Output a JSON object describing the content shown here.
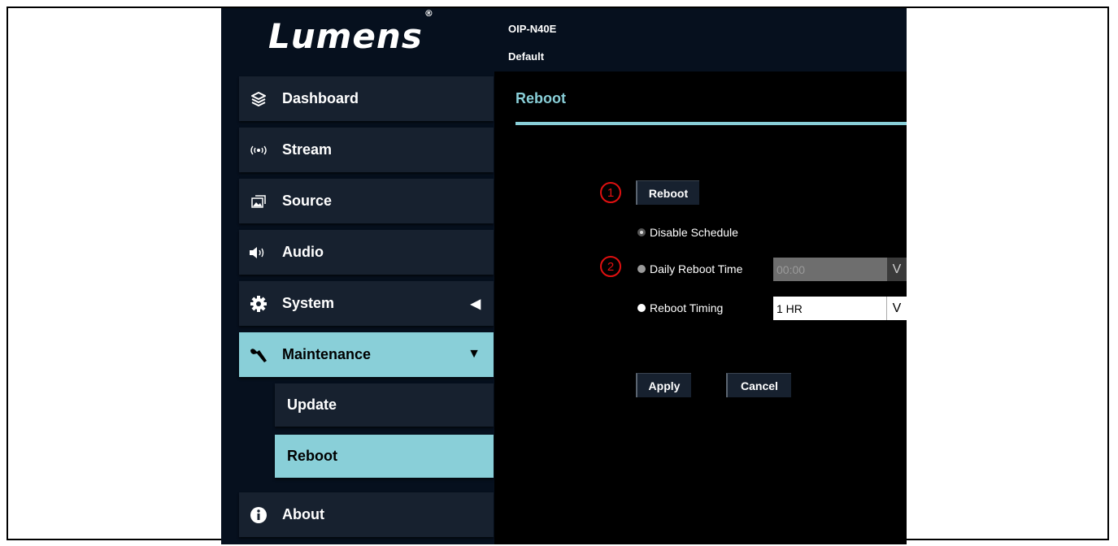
{
  "brand": {
    "logo_text": "Lumens",
    "registered_mark": "®"
  },
  "header": {
    "model": "OIP-N40E",
    "profile": "Default"
  },
  "sidebar": {
    "items": [
      {
        "label": "Dashboard",
        "icon": "layers-icon"
      },
      {
        "label": "Stream",
        "icon": "broadcast-icon"
      },
      {
        "label": "Source",
        "icon": "image-source-icon"
      },
      {
        "label": "Audio",
        "icon": "speaker-icon"
      },
      {
        "label": "System",
        "icon": "gear-icon",
        "caret": "◀"
      },
      {
        "label": "Maintenance",
        "icon": "wrench-icon",
        "caret": "▼",
        "active": true
      },
      {
        "label": "About",
        "icon": "info-icon"
      }
    ],
    "subitems": [
      {
        "label": "Update"
      },
      {
        "label": "Reboot",
        "active": true
      }
    ]
  },
  "content": {
    "title": "Reboot",
    "reboot_button": "Reboot",
    "callouts": [
      "1",
      "2"
    ],
    "options": [
      {
        "label": "Disable Schedule",
        "state": "checked"
      },
      {
        "label": "Daily Reboot Time",
        "state": "disabled",
        "select_value": "00:00",
        "select_arrow": "V"
      },
      {
        "label": "Reboot Timing",
        "state": "unchecked",
        "select_value": "1 HR",
        "select_arrow": "V"
      }
    ],
    "apply_button": "Apply",
    "cancel_button": "Cancel"
  },
  "colors": {
    "accent": "#89cfd8",
    "panel": "#17212f",
    "background": "#000000",
    "callout": "#e01010"
  }
}
